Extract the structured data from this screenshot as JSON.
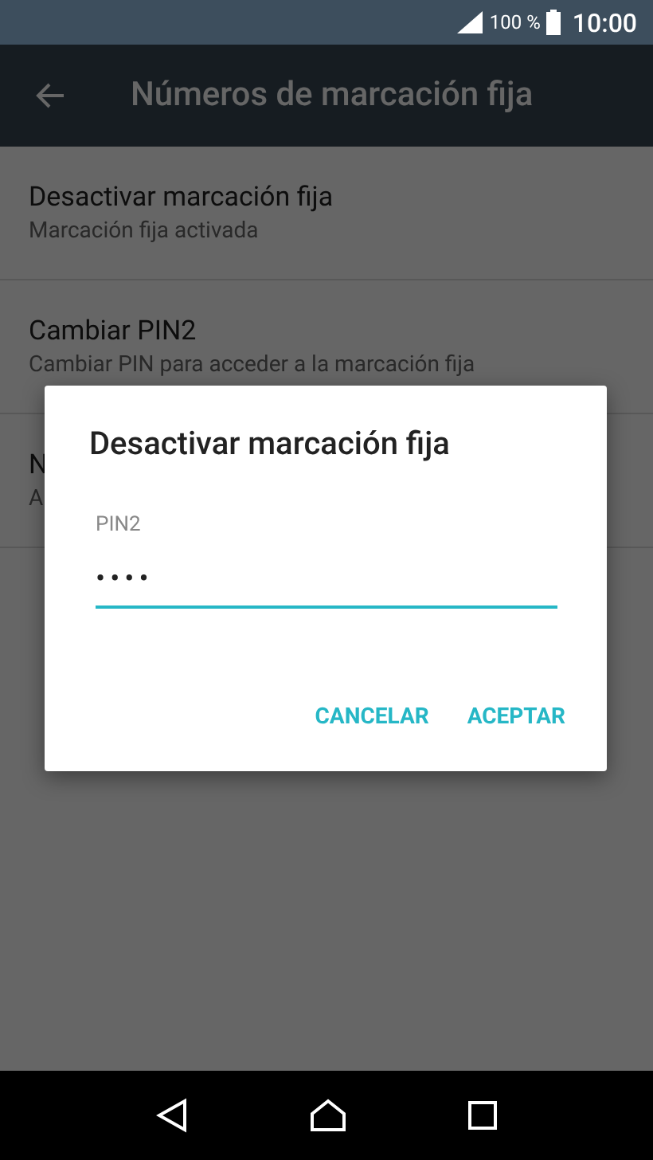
{
  "status_bar": {
    "battery": "100 %",
    "time": "10:00"
  },
  "app_bar": {
    "title": "Números de marcación fija"
  },
  "items": [
    {
      "title": "Desactivar marcación fija",
      "subtitle": "Marcación fija activada"
    },
    {
      "title": "Cambiar PIN2",
      "subtitle": "Cambiar PIN para acceder a la marcación fija"
    },
    {
      "title": "N",
      "subtitle": "A"
    }
  ],
  "dialog": {
    "title": "Desactivar marcación fija",
    "field_label": "PIN2",
    "value": "••••",
    "buttons": [
      "CANCELAR",
      "ACEPTAR"
    ]
  }
}
